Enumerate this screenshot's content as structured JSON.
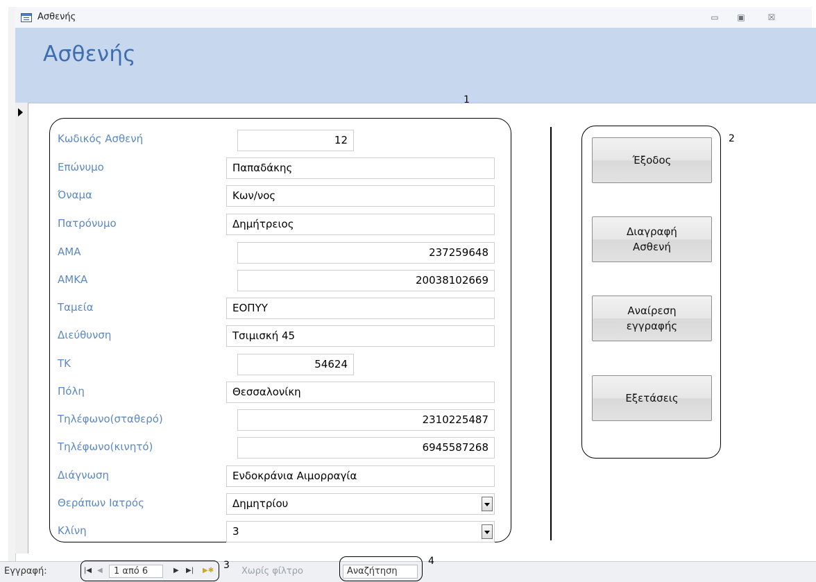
{
  "window": {
    "title": "Ασθενής",
    "controls": {
      "minimize": "▭",
      "restore": "▣",
      "close": "☒"
    }
  },
  "header": {
    "title": "Ασθενής"
  },
  "annotations": [
    "1",
    "2",
    "3",
    "4"
  ],
  "form": {
    "fields": [
      {
        "label": "Κωδικός Ασθενή",
        "value": "12"
      },
      {
        "label": "Επώνυμο",
        "value": "Παπαδάκης"
      },
      {
        "label": "Όναμα",
        "value": "Κων/νος"
      },
      {
        "label": "Πατρόνυμο",
        "value": "Δημήτρειος"
      },
      {
        "label": "ΑΜΑ",
        "value": "237259648"
      },
      {
        "label": "ΑΜΚΑ",
        "value": "20038102669"
      },
      {
        "label": "Ταμεία",
        "value": "ΕΟΠΥΥ"
      },
      {
        "label": "Διεύθυνση",
        "value": "Τσιμισκή 45"
      },
      {
        "label": "ΤΚ",
        "value": "54624"
      },
      {
        "label": "Πόλη",
        "value": "Θεσσαλονίκη"
      },
      {
        "label": "Τηλέφωνο(σταθερό)",
        "value": "2310225487"
      },
      {
        "label": "Τηλέφωνο(κινητό)",
        "value": "6945587268"
      },
      {
        "label": "Διάγνωση",
        "value": "Ενδοκράνια Αιμορραγία"
      },
      {
        "label": "Θεράπων Ιατρός",
        "value": "Δημητρίου"
      },
      {
        "label": "Κλίνη",
        "value": "3"
      }
    ]
  },
  "buttons": {
    "exit": "Έξοδος",
    "delete_patient": "Διαγραφή\nΑσθενή",
    "undo_record": "Αναίρεση\nεγγραφής",
    "exams": "Εξετάσεις"
  },
  "navigation": {
    "record_label": "Εγγραφή:",
    "position": "1 από 6",
    "filter": "Χωρίς φίλτρο",
    "search": "Αναζήτηση",
    "glyphs": {
      "first": "|◀",
      "prev": "◀",
      "next": "▶",
      "last": "▶|",
      "new": "▶✱"
    }
  }
}
